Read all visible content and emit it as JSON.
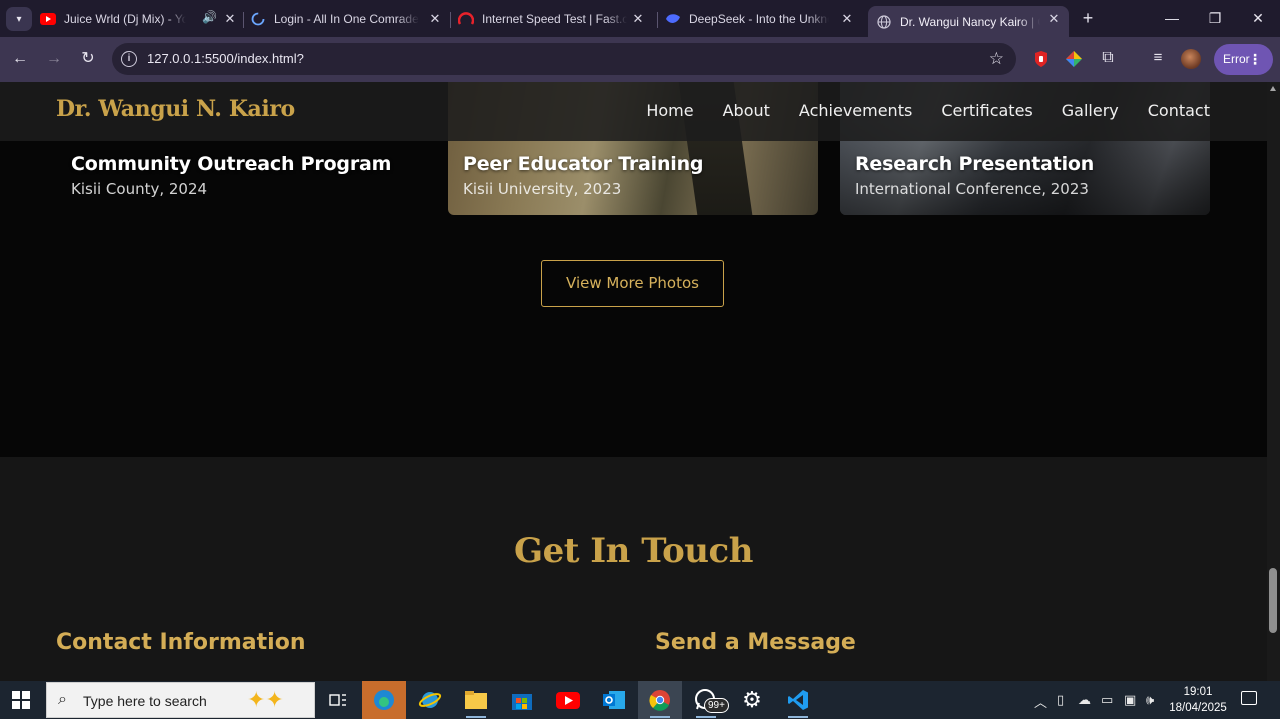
{
  "browser": {
    "tabs": [
      {
        "title": "Juice Wrld (Dj Mix) - You",
        "favicon": "youtube-icon",
        "audio": true
      },
      {
        "title": "Login - All In One Comrade",
        "favicon": "loading-icon"
      },
      {
        "title": "Internet Speed Test | Fast.co",
        "favicon": "fast-icon"
      },
      {
        "title": "DeepSeek - Into the Unknow",
        "favicon": "deepseek-icon"
      },
      {
        "title": "Dr. Wangui Nancy Kairo | Co",
        "favicon": "globe-icon",
        "active": true
      }
    ],
    "new_tab": "+",
    "window_controls": {
      "minimize": "—",
      "maximize": "❐",
      "close": "✕"
    },
    "url": "127.0.0.1:5500/index.html?",
    "error_label": "Error"
  },
  "site": {
    "brand": "Dr. Wangui N. Kairo",
    "nav": [
      "Home",
      "About",
      "Achievements",
      "Certificates",
      "Gallery",
      "Contact"
    ],
    "gallery": {
      "cards": [
        {
          "title": "Community Outreach Program",
          "subtitle": "Kisii County, 2024"
        },
        {
          "title": "Peer Educator Training",
          "subtitle": "Kisii University, 2023"
        },
        {
          "title": "Research Presentation",
          "subtitle": "International Conference, 2023"
        }
      ],
      "view_more": "View More Photos"
    },
    "contact": {
      "title": "Get In Touch",
      "info_heading": "Contact Information",
      "message_heading": "Send a Message"
    }
  },
  "taskbar": {
    "search_placeholder": "Type here to search",
    "whatsapp_badge": "99+",
    "time": "19:01",
    "date": "18/04/2025"
  }
}
